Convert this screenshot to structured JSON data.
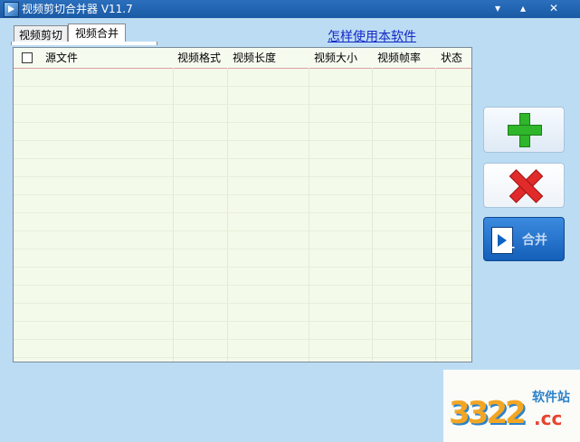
{
  "window": {
    "title": "视频剪切合并器 V11.7",
    "controls": [
      "▾",
      "▴",
      "✕"
    ]
  },
  "tabs": [
    {
      "label": "视频剪切",
      "active": false
    },
    {
      "label": "视频合并",
      "active": true
    }
  ],
  "help_link": "怎样使用本软件",
  "table": {
    "columns": [
      "源文件",
      "视频格式",
      "视频长度",
      "视频大小",
      "视频帧率",
      "状态"
    ],
    "rows": []
  },
  "side_buttons": {
    "add_icon": "plus-icon",
    "delete_icon": "x-icon",
    "merge_icon": "film-icon",
    "merge_label": "合并"
  },
  "watermark": {
    "number": "3322",
    "site": "软件站",
    "domain": ".cc"
  },
  "colors": {
    "titlebar": "#1b5aa5",
    "background": "#bcdcf3",
    "table_bg": "#f4faea",
    "link": "#1428c8",
    "add_green": "#2fb62b",
    "delete_red": "#e12a2a",
    "merge_blue": "#145fb9"
  }
}
